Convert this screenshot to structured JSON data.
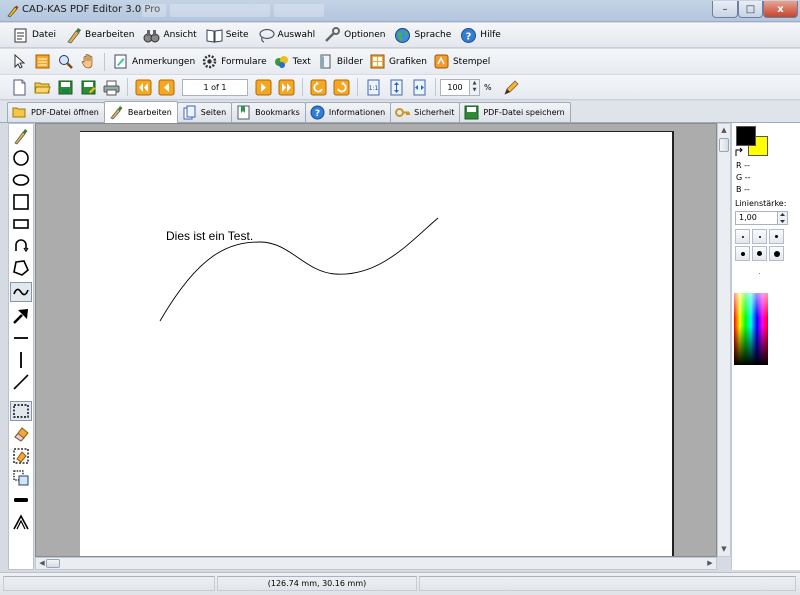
{
  "window": {
    "title": "CAD-KAS PDF Editor 3.0 Pro",
    "min_symbol": "–",
    "max_symbol": "□",
    "close_symbol": "x"
  },
  "menu": [
    {
      "label": "Datei",
      "icon": "document-icon"
    },
    {
      "label": "Bearbeiten",
      "icon": "brush-icon"
    },
    {
      "label": "Ansicht",
      "icon": "binoculars-icon"
    },
    {
      "label": "Seite",
      "icon": "book-icon"
    },
    {
      "label": "Auswahl",
      "icon": "lasso-icon"
    },
    {
      "label": "Optionen",
      "icon": "wrench-icon"
    },
    {
      "label": "Sprache",
      "icon": "globe-icon"
    },
    {
      "label": "Hilfe",
      "icon": "help-icon"
    }
  ],
  "toolbar1": {
    "annotations": "Anmerkungen",
    "forms": "Formulare",
    "text": "Text",
    "images": "Bilder",
    "graphics": "Grafiken",
    "stamps": "Stempel"
  },
  "toolbar2": {
    "page_indicator": "1 of 1",
    "zoom_value": "100",
    "zoom_unit": "%",
    "spin_up": "▲",
    "spin_down": "▼"
  },
  "tabs": [
    {
      "label": "PDF-Datei öffnen",
      "active": false
    },
    {
      "label": "Bearbeiten",
      "active": true
    },
    {
      "label": "Seiten",
      "active": false
    },
    {
      "label": "Bookmarks",
      "active": false
    },
    {
      "label": "Informationen",
      "active": false
    },
    {
      "label": "Sicherheit",
      "active": false
    },
    {
      "label": "PDF-Datei speichern",
      "active": false
    }
  ],
  "document": {
    "text": "Dies ist ein Test."
  },
  "color_panel": {
    "r_label": "R --",
    "g_label": "G --",
    "b_label": "B --",
    "line_width_label": "Linienstärke:",
    "line_width_value": "1,00",
    "foreground_color": "#000000",
    "background_color": "#ffff00"
  },
  "scroll": {
    "up": "▲",
    "down": "▼",
    "left": "◀",
    "right": "▶"
  },
  "status": {
    "coordinates": "(126.74 mm, 30.16 mm)"
  }
}
